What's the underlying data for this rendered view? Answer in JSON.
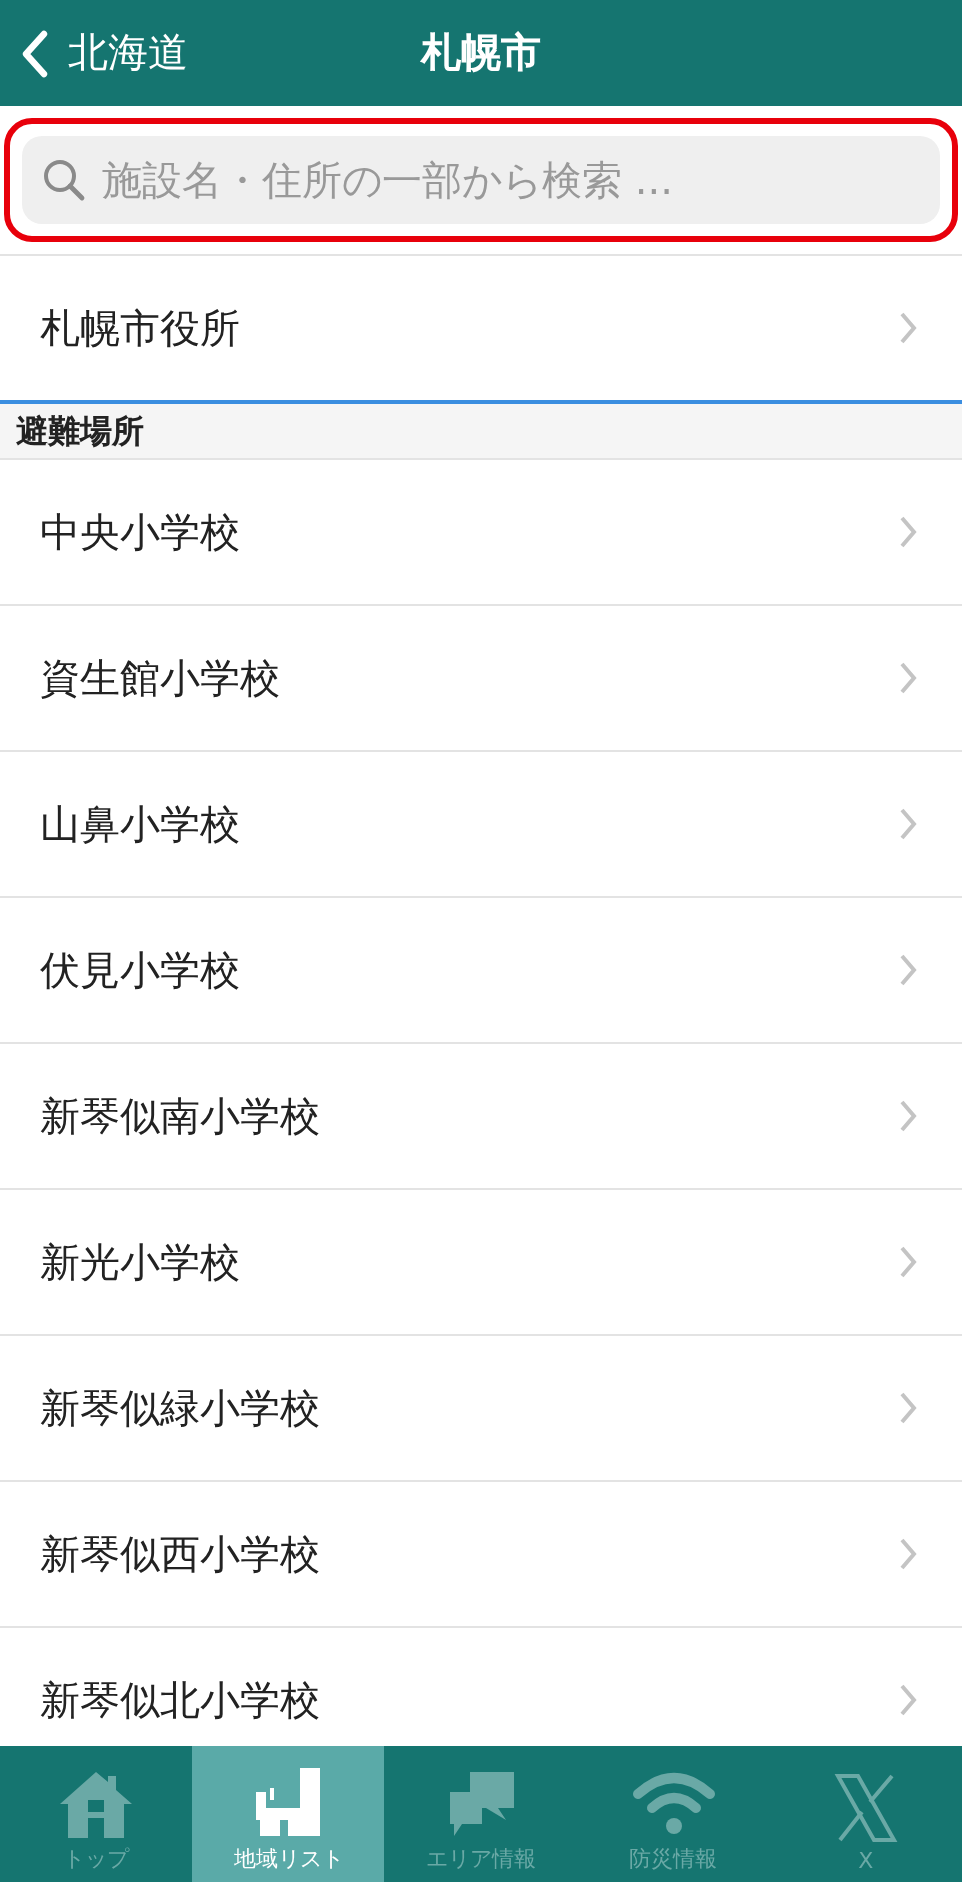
{
  "header": {
    "back_label": "北海道",
    "title": "札幌市"
  },
  "search": {
    "placeholder": "施設名・住所の一部から検索 ...",
    "highlighted": true
  },
  "top_items": [
    "札幌市役所"
  ],
  "section": {
    "title": "避難場所",
    "items": [
      "中央小学校",
      "資生館小学校",
      "山鼻小学校",
      "伏見小学校",
      "新琴似南小学校",
      "新光小学校",
      "新琴似緑小学校",
      "新琴似西小学校",
      "新琴似北小学校"
    ]
  },
  "tabs": [
    {
      "kind": "home",
      "label": "トップ",
      "selected": false
    },
    {
      "kind": "region",
      "label": "地域リスト",
      "selected": true
    },
    {
      "kind": "chat",
      "label": "エリア情報",
      "selected": false
    },
    {
      "kind": "wifi",
      "label": "防災情報",
      "selected": false
    },
    {
      "kind": "x",
      "label": "X",
      "selected": false
    }
  ]
}
